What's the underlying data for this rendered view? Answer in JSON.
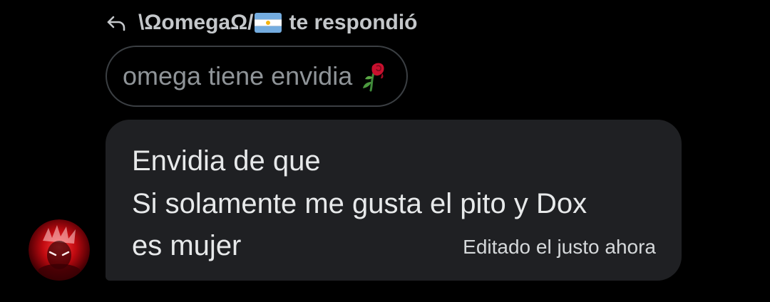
{
  "reply_header": {
    "icon": "reply-arrow-icon",
    "username": "\\ΩomegaΩ/",
    "flag_icon": "argentina-flag-icon",
    "action": "te respondió"
  },
  "quoted_message": {
    "text": "omega tiene envidia",
    "emoji_icon": "wilted-rose-icon"
  },
  "message": {
    "lines": [
      "Envidia de que",
      "Si solamente me gusta el pito y Dox",
      "es mujer"
    ],
    "edited_label": "Editado el justo ahora"
  },
  "avatar": {
    "icon": "user-avatar-icon"
  },
  "colors": {
    "background": "#000000",
    "bubble": "#1f2023",
    "text": "#e7e9ea",
    "muted": "#8f9498",
    "quote_border": "#3b3f43"
  }
}
